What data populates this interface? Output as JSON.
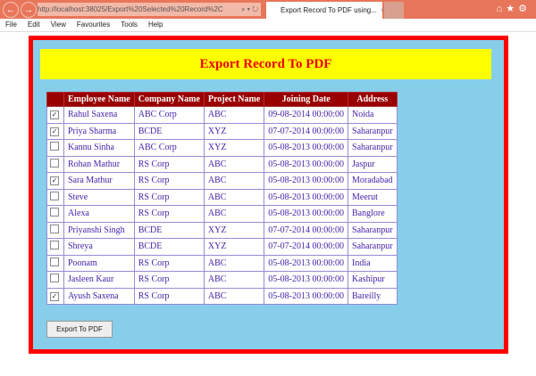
{
  "browser": {
    "url": "http://localhost:38025/Export%20Selected%20Record%2C",
    "tab_title": "Export Record To PDF using...",
    "menu": [
      "File",
      "Edit",
      "View",
      "Favourites",
      "Tools",
      "Help"
    ]
  },
  "page": {
    "title": "Export Record To PDF",
    "button": "Export To PDF"
  },
  "table": {
    "headers": [
      "",
      "Employee Name",
      "Company Name",
      "Project Name",
      "Joining Date",
      "Address"
    ],
    "rows": [
      {
        "checked": true,
        "name": "Rahul Saxena",
        "company": "ABC Corp",
        "project": "ABC",
        "date": "09-08-2014 00:00:00",
        "address": "Noida"
      },
      {
        "checked": true,
        "name": "Priya Sharma",
        "company": "BCDE",
        "project": "XYZ",
        "date": "07-07-2014 00:00:00",
        "address": "Saharanpur"
      },
      {
        "checked": false,
        "name": "Kannu Sinha",
        "company": "ABC Corp",
        "project": "XYZ",
        "date": "05-08-2013 00:00:00",
        "address": "Saharanpur"
      },
      {
        "checked": false,
        "name": "Rohan Mathur",
        "company": "RS Corp",
        "project": "ABC",
        "date": "05-08-2013 00:00:00",
        "address": "Jaspur"
      },
      {
        "checked": true,
        "name": "Sara Mathur",
        "company": "RS Corp",
        "project": "ABC",
        "date": "05-08-2013 00:00:00",
        "address": "Moradabad"
      },
      {
        "checked": false,
        "name": "Steve",
        "company": "RS Corp",
        "project": "ABC",
        "date": "05-08-2013 00:00:00",
        "address": "Meerut"
      },
      {
        "checked": false,
        "name": "Alexa",
        "company": "RS Corp",
        "project": "ABC",
        "date": "05-08-2013 00:00:00",
        "address": "Banglore"
      },
      {
        "checked": false,
        "name": "Priyanshi Singh",
        "company": "BCDE",
        "project": "XYZ",
        "date": "07-07-2014 00:00:00",
        "address": "Saharanpur"
      },
      {
        "checked": false,
        "name": "Shreya",
        "company": "BCDE",
        "project": "XYZ",
        "date": "07-07-2014 00:00:00",
        "address": "Saharanpur"
      },
      {
        "checked": false,
        "name": "Poonam",
        "company": "RS Corp",
        "project": "ABC",
        "date": "05-08-2013 00:00:00",
        "address": "India"
      },
      {
        "checked": false,
        "name": "Jasleen Kaur",
        "company": "RS Corp",
        "project": "ABC",
        "date": "05-08-2013 00:00:00",
        "address": "Kashipur"
      },
      {
        "checked": true,
        "name": "Ayush Saxena",
        "company": "RS Corp",
        "project": "ABC",
        "date": "05-08-2013 00:00:00",
        "address": "Bareilly"
      }
    ]
  }
}
